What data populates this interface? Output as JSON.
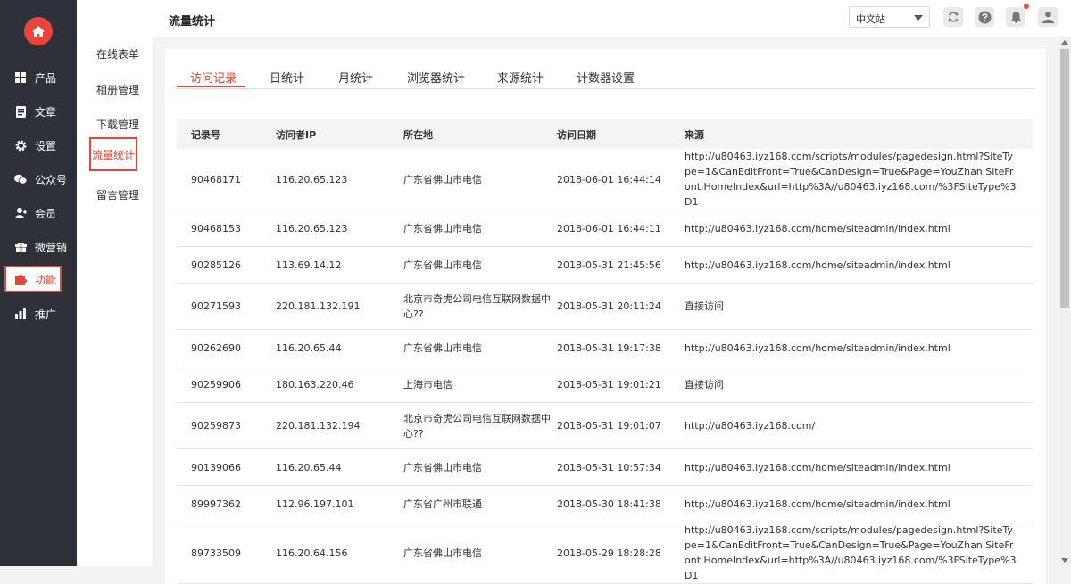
{
  "colors": {
    "accent": "#e8443a",
    "nav_bg": "#2e3238"
  },
  "nav": {
    "items": [
      {
        "label": "产品",
        "icon": "grid-icon"
      },
      {
        "label": "文章",
        "icon": "document-icon"
      },
      {
        "label": "设置",
        "icon": "gear-icon"
      },
      {
        "label": "公众号",
        "icon": "wechat-icon"
      },
      {
        "label": "会员",
        "icon": "member-icon"
      },
      {
        "label": "微营销",
        "icon": "gift-icon"
      },
      {
        "label": "功能",
        "icon": "puzzle-icon"
      },
      {
        "label": "推广",
        "icon": "bar-chart-icon"
      }
    ]
  },
  "submenu": {
    "items": [
      {
        "label": "在线表单"
      },
      {
        "label": "相册管理"
      },
      {
        "label": "下载管理"
      },
      {
        "label": "流量统计"
      },
      {
        "label": "留言管理"
      }
    ]
  },
  "header": {
    "title": "流量统计",
    "language": "中文站"
  },
  "tabs": [
    {
      "label": "访问记录"
    },
    {
      "label": "日统计"
    },
    {
      "label": "月统计"
    },
    {
      "label": "浏览器统计"
    },
    {
      "label": "来源统计"
    },
    {
      "label": "计数器设置"
    }
  ],
  "table": {
    "columns": [
      "记录号",
      "访问者IP",
      "所在地",
      "访问日期",
      "来源"
    ],
    "rows": [
      {
        "id": "90468171",
        "ip": "116.20.65.123",
        "location": "广东省佛山市电信",
        "date": "2018-06-01 16:44:14",
        "source": "http://u80463.iyz168.com/scripts/modules/pagedesign.html?SiteType=1&CanEditFront=True&CanDesign=True&Page=YouZhan.SiteFront.HomeIndex&url=http%3A//u80463.iyz168.com/%3FSiteType%3D1"
      },
      {
        "id": "90468153",
        "ip": "116.20.65.123",
        "location": "广东省佛山市电信",
        "date": "2018-06-01 16:44:11",
        "source": "http://u80463.iyz168.com/home/siteadmin/index.html"
      },
      {
        "id": "90285126",
        "ip": "113.69.14.12",
        "location": "广东省佛山市电信",
        "date": "2018-05-31 21:45:56",
        "source": "http://u80463.iyz168.com/home/siteadmin/index.html"
      },
      {
        "id": "90271593",
        "ip": "220.181.132.191",
        "location": "北京市奇虎公司电信互联网数据中心??",
        "date": "2018-05-31 20:11:24",
        "source": "直接访问"
      },
      {
        "id": "90262690",
        "ip": "116.20.65.44",
        "location": "广东省佛山市电信",
        "date": "2018-05-31 19:17:38",
        "source": "http://u80463.iyz168.com/home/siteadmin/index.html"
      },
      {
        "id": "90259906",
        "ip": "180.163.220.46",
        "location": "上海市电信",
        "date": "2018-05-31 19:01:21",
        "source": "直接访问"
      },
      {
        "id": "90259873",
        "ip": "220.181.132.194",
        "location": "北京市奇虎公司电信互联网数据中心??",
        "date": "2018-05-31 19:01:07",
        "source": "http://u80463.iyz168.com/"
      },
      {
        "id": "90139066",
        "ip": "116.20.65.44",
        "location": "广东省佛山市电信",
        "date": "2018-05-31 10:57:34",
        "source": "http://u80463.iyz168.com/home/siteadmin/index.html"
      },
      {
        "id": "89997362",
        "ip": "112.96.197.101",
        "location": "广东省广州市联通",
        "date": "2018-05-30 18:41:38",
        "source": "http://u80463.iyz168.com/home/siteadmin/index.html"
      },
      {
        "id": "89733509",
        "ip": "116.20.64.156",
        "location": "广东省佛山市电信",
        "date": "2018-05-29 18:28:28",
        "source": "http://u80463.iyz168.com/scripts/modules/pagedesign.html?SiteType=1&CanEditFront=True&CanDesign=True&Page=YouZhan.SiteFront.HomeIndex&url=http%3A//u80463.iyz168.com/%3FSiteType%3D1"
      }
    ]
  }
}
